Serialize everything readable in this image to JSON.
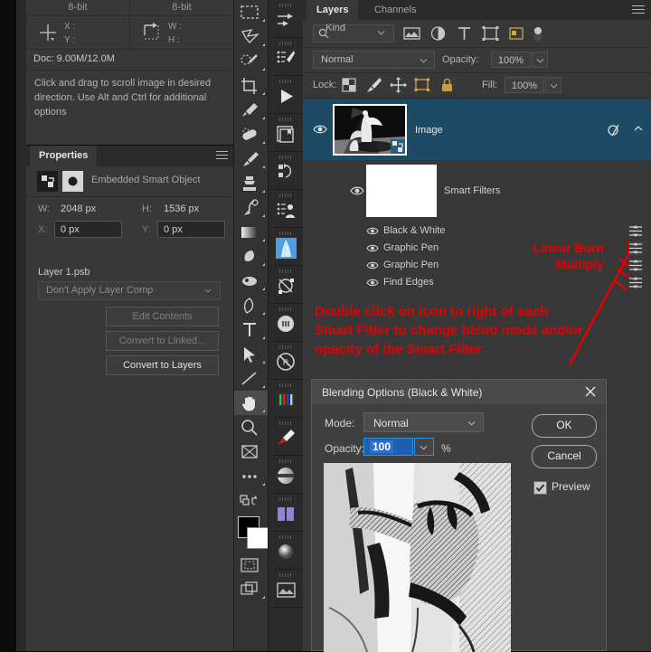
{
  "info_panel": {
    "bit_depth_left": "8-bit",
    "bit_depth_right": "8-bit",
    "xy_labels": "X :\nY :",
    "x_label": "X :",
    "y_label": "Y :",
    "w_label": "W :",
    "h_label": "H :",
    "doc_text": "Doc: 9.00M/12.0M",
    "hint_text": "Click and drag to scroll image in desired direction.  Use Alt and Ctrl for additional options",
    "icons": {
      "move": "move-crosshair-icon",
      "bounds": "selection-bounds-icon"
    }
  },
  "properties": {
    "tab_label": "Properties",
    "menu_icon": "panel-menu-icon",
    "header_label": "Embedded Smart Object",
    "badge_left_icon": "smart-object-icon",
    "badge_right_icon": "mask-thumbnail-icon",
    "w_label": "W:",
    "w_value": "2048 px",
    "h_label": "H:",
    "h_value": "1536 px",
    "x_label": "X:",
    "x_value": "0 px",
    "y_label": "Y:",
    "y_value": "0 px",
    "layer_name": "Layer 1.psb",
    "layer_comp": "Don't Apply Layer Comp",
    "layer_comp_chevron": "chevron-down-icon",
    "buttons": {
      "edit_contents": "Edit Contents",
      "convert_to_linked": "Convert to Linked...",
      "convert_to_layers": "Convert to Layers"
    }
  },
  "tools": [
    {
      "name": "marquee-tool",
      "icon": "rectangular-marquee-icon",
      "selected": false
    },
    {
      "name": "lasso-tool",
      "icon": "polygonal-lasso-icon",
      "selected": false
    },
    {
      "name": "quick-selection-tool",
      "icon": "quick-selection-icon",
      "selected": false
    },
    {
      "name": "crop-tool",
      "icon": "crop-icon",
      "selected": false
    },
    {
      "name": "eyedropper-tool",
      "icon": "eyedropper-icon",
      "selected": false
    },
    {
      "name": "healing-brush-tool",
      "icon": "spot-healing-icon",
      "selected": false
    },
    {
      "name": "brush-tool",
      "icon": "paintbrush-icon",
      "selected": false
    },
    {
      "name": "clone-stamp-tool",
      "icon": "clone-stamp-icon",
      "selected": false
    },
    {
      "name": "history-brush-tool",
      "icon": "history-brush-icon",
      "selected": false
    },
    {
      "name": "gradient-tool",
      "icon": "gradient-icon",
      "selected": false
    },
    {
      "name": "dodge-tool",
      "icon": "dodge-icon",
      "selected": false
    },
    {
      "name": "blur-tool",
      "icon": "blur-droplet-icon",
      "selected": false
    },
    {
      "name": "pen-tool",
      "icon": "pen-icon",
      "selected": false
    },
    {
      "name": "type-tool",
      "icon": "text-T-icon",
      "selected": false
    },
    {
      "name": "path-selection-tool",
      "icon": "path-arrow-icon",
      "selected": false
    },
    {
      "name": "line-tool",
      "icon": "line-shape-icon",
      "selected": false
    },
    {
      "name": "hand-tool",
      "icon": "hand-icon",
      "selected": true
    },
    {
      "name": "zoom-tool",
      "icon": "magnifier-icon",
      "selected": false
    },
    {
      "name": "frame-tool",
      "icon": "frame-icon",
      "selected": false
    },
    {
      "name": "edit-toolbar-tool",
      "icon": "ellipsis-icon",
      "selected": false
    },
    {
      "name": "screen-mode-tool",
      "icon": "screen-mode-icon",
      "selected": false
    }
  ],
  "swatches": {
    "foreground": "#000000",
    "background": "#ffffff",
    "quick_mask_icon": "quick-mask-icon",
    "screen_mode_icon": "screen-mode-icon"
  },
  "dock": [
    {
      "name": "dock-adjustments",
      "icon": "adjustments-sliders-icon",
      "selected": false
    },
    {
      "name": "dock-brush-settings",
      "icon": "brush-settings-icon",
      "selected": false
    },
    {
      "name": "dock-timeline",
      "icon": "play-triangle-icon",
      "selected": false
    },
    {
      "name": "dock-libraries",
      "icon": "libraries-book-icon",
      "selected": false
    },
    {
      "name": "dock-history",
      "icon": "history-undo-icon",
      "selected": false
    },
    {
      "name": "dock-actions",
      "icon": "actions-list-icon",
      "selected": false
    },
    {
      "name": "dock-navigator",
      "icon": "navigator-thumbnail-icon",
      "selected": true
    },
    {
      "name": "dock-paths",
      "icon": "paths-node-icon",
      "selected": false
    },
    {
      "name": "dock-info",
      "icon": "info-circle-icon",
      "selected": false
    },
    {
      "name": "dock-no-symbol",
      "icon": "no-symbol-icon",
      "selected": false
    },
    {
      "name": "dock-channels-rgb",
      "icon": "rgb-bars-icon",
      "selected": false
    },
    {
      "name": "dock-color",
      "icon": "color-dropper-icon",
      "selected": false
    },
    {
      "name": "dock-gradients",
      "icon": "gradient-sphere-icon",
      "selected": false
    },
    {
      "name": "dock-swatches",
      "icon": "swatch-pair-icon",
      "selected": false
    },
    {
      "name": "dock-styles",
      "icon": "style-sphere-icon",
      "selected": false
    },
    {
      "name": "dock-patterns",
      "icon": "pattern-tile-icon",
      "selected": false
    }
  ],
  "layers": {
    "tabs": [
      {
        "label": "Layers",
        "active": true
      },
      {
        "label": "Channels",
        "active": false
      }
    ],
    "menu_icon": "panel-menu-icon",
    "filter": {
      "kind_label": "Kind",
      "search_icon": "search-icon",
      "chevron_icon": "chevron-down-icon",
      "type_icons": [
        "pixel-layer-icon",
        "adjustment-layer-icon",
        "type-layer-icon",
        "shape-layer-icon",
        "smart-object-icon",
        "toggle-filter-switch-icon"
      ]
    },
    "blend_mode": "Normal",
    "opacity_label": "Opacity:",
    "opacity_value": "100%",
    "lock_label": "Lock:",
    "lock_icons": [
      "lock-transparency-icon",
      "lock-image-icon",
      "lock-position-icon",
      "lock-artboard-icon",
      "lock-all-icon"
    ],
    "fill_label": "Fill:",
    "fill_value": "100%",
    "item": {
      "name": "Image",
      "eye_icon": "eye-visible-icon",
      "thumbnail": "smart-object-thumbnail",
      "smart_badge_icon": "smart-object-badge-icon",
      "fx_icon": "smart-filter-fx-icon",
      "collapse_icon": "chevron-up-icon",
      "selected": true
    },
    "smart_filters": {
      "label": "Smart Filters",
      "eye_icon": "eye-visible-icon",
      "mask_thumbnail": "white-filter-mask"
    },
    "filters": [
      {
        "name": "Black & White",
        "eye_icon": "eye-visible-icon",
        "options_icon": "blending-options-icon",
        "highlighted": false
      },
      {
        "name": "Graphic Pen",
        "eye_icon": "eye-visible-icon",
        "options_icon": "blending-options-icon",
        "highlighted": true
      },
      {
        "name": "Graphic Pen",
        "eye_icon": "eye-visible-icon",
        "options_icon": "blending-options-icon",
        "highlighted": false
      },
      {
        "name": "Find Edges",
        "eye_icon": "eye-visible-icon",
        "options_icon": "blending-options-icon",
        "highlighted": false
      }
    ]
  },
  "annotations": {
    "color": "#e60000",
    "linear_burn": "Linear Burn",
    "multiply": "Multiply",
    "main_text": "Double click on icon to right of each Smart Filter to change blend mode and/or opacity of the Smart Filter",
    "arrow_icon": "red-pointer-line-icon"
  },
  "dialog": {
    "title": "Blending Options (Black & White)",
    "close_icon": "close-x-icon",
    "mode_label": "Mode:",
    "mode_value": "Normal",
    "mode_chevron": "chevron-down-icon",
    "opacity_label": "Opacity:",
    "opacity_value": "100",
    "opacity_chevron": "chevron-down-icon",
    "percent_symbol": "%",
    "ok_label": "OK",
    "cancel_label": "Cancel",
    "preview_label": "Preview",
    "preview_checked": true,
    "preview_image": "graphic-pen-sketch-preview"
  }
}
